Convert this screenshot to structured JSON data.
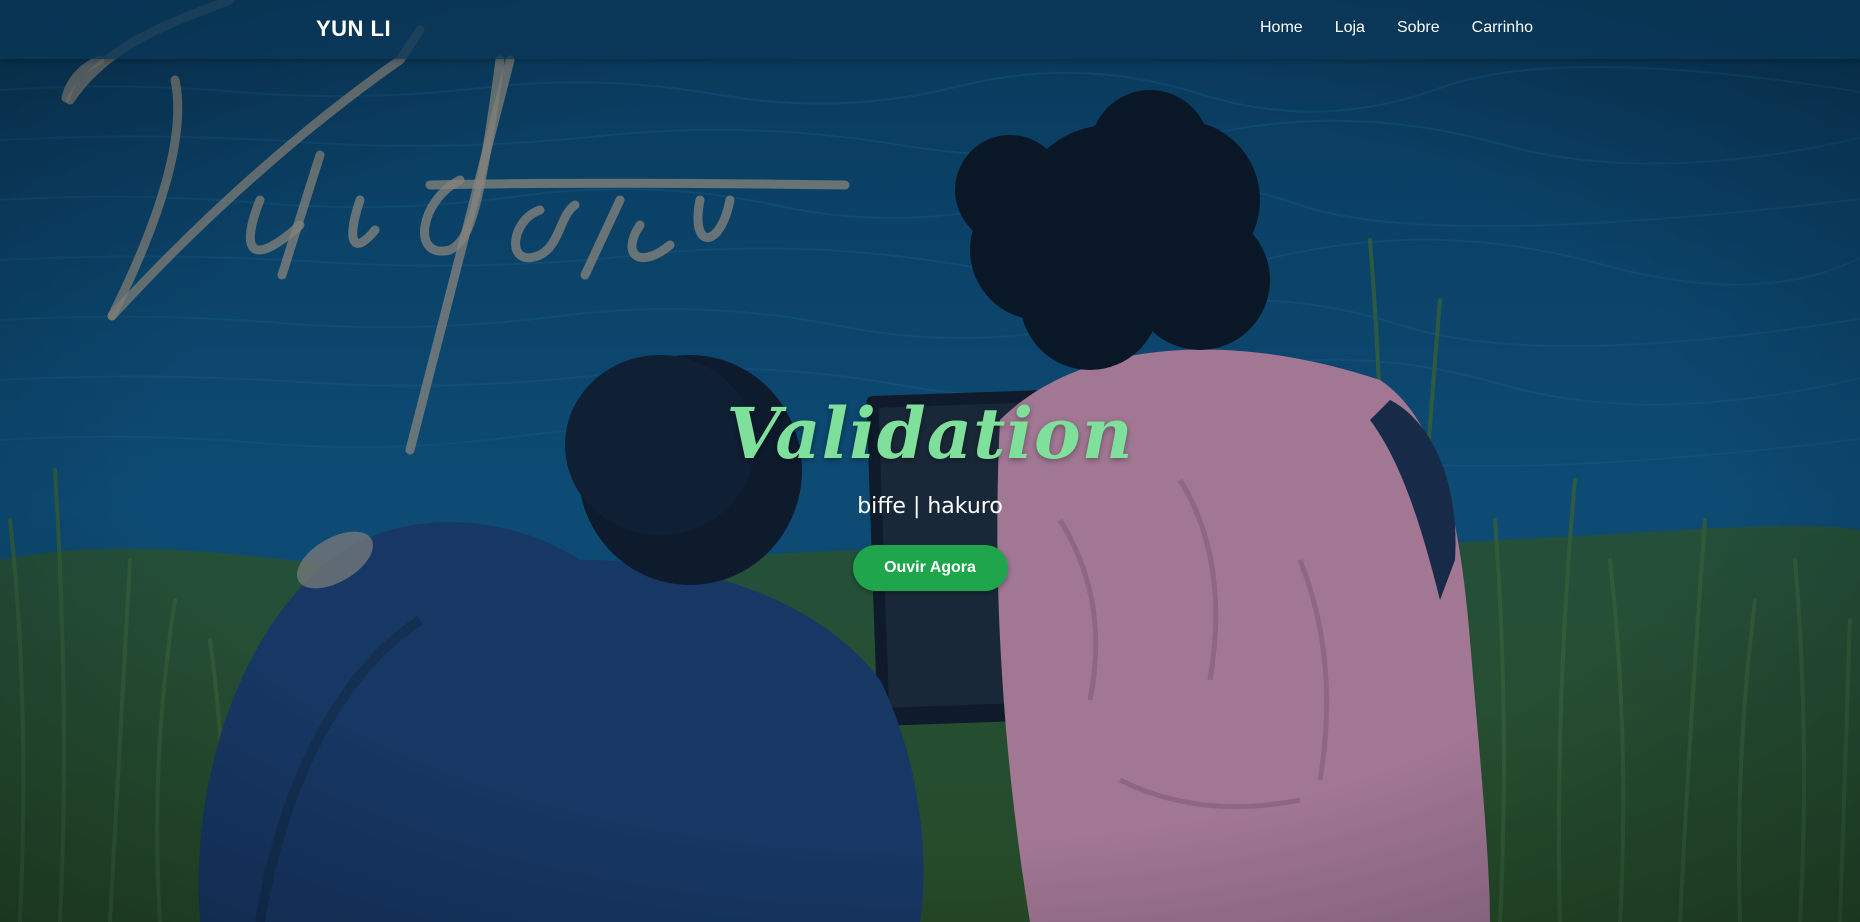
{
  "header": {
    "brand": "YUN LI",
    "nav": [
      {
        "label": "Home"
      },
      {
        "label": "Loja"
      },
      {
        "label": "Sobre"
      },
      {
        "label": "Carrinho"
      }
    ]
  },
  "hero": {
    "background_art_text": "Validation",
    "title": "Validation",
    "artists": "biffe | hakuro",
    "cta_label": "Ouvir Agora"
  },
  "colors": {
    "navbar": "#0a3758",
    "title_accent": "#7ee09a",
    "cta_button": "#1fa64c",
    "water": "#0e4e78",
    "grass": "#2f5a2a",
    "jacket_blue": "#1b3d6e",
    "shirt_pink": "#c48aa8"
  }
}
